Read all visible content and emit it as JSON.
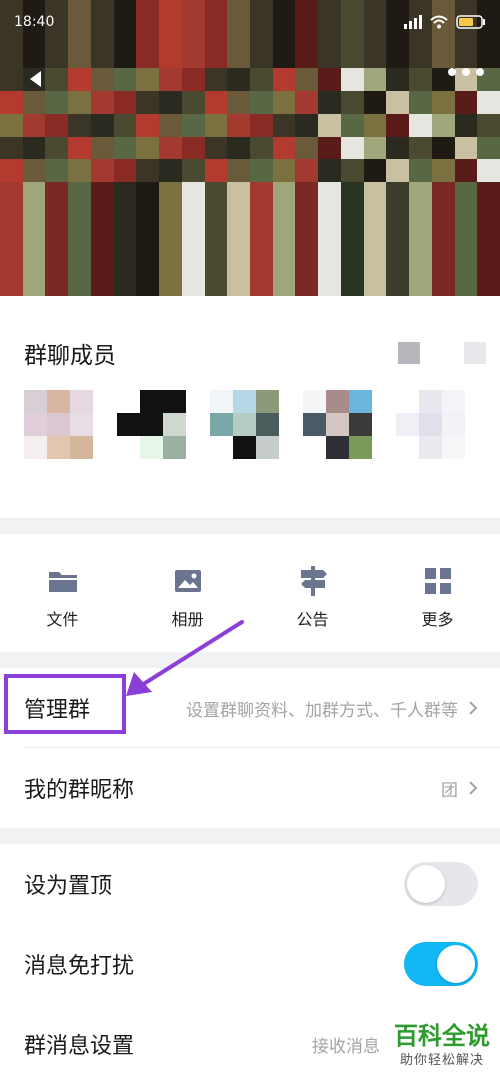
{
  "status_bar": {
    "time": "18:40"
  },
  "header": {
    "back_icon": "chevron-left-icon",
    "more_icon": "more-dots-icon",
    "cover_colors": [
      "#3b3528",
      "#6b5a3a",
      "#8a2a25",
      "#b33a2e",
      "#a33a30",
      "#4a4a30",
      "#7b7040",
      "#2b2a20",
      "#586844",
      "#9fa67a",
      "#c8c0a0",
      "#e6e6e0",
      "#201a14",
      "#5a1c18",
      "#7a2a24",
      "#3c3c2c",
      "#2a3424",
      "#a7b079",
      "#c6cf9a",
      "#dcdccc",
      "#16110c",
      "#4e3a2a"
    ]
  },
  "members": {
    "title": "群聊成员",
    "avatar_palettes": [
      [
        "#d8cfd6",
        "#d9b6a3",
        "#e6d8e2",
        "#e0cfda",
        "#dbc7d2",
        "#e7dde5",
        "#f4eeef",
        "#e2c6b0",
        "#d4b69b"
      ],
      [
        "#ffffff",
        "#111111",
        "#111111",
        "#111111",
        "#111111",
        "#cfd8cf",
        "#ffffff",
        "#e6f6e8",
        "#9bb0a0"
      ],
      [
        "#f0f6f8",
        "#b6d8e6",
        "#8c9a7a",
        "#7aa6a8",
        "#b4ccc2",
        "#4a5c5c",
        "#ffffff",
        "#111111",
        "#c6cbcb"
      ],
      [
        "#f3f5f7",
        "#a88c8c",
        "#6ab6dc",
        "#4a5a66",
        "#d4c6c0",
        "#3a3a3a",
        "#ffffff",
        "#2e2e36",
        "#7a9a5a"
      ],
      [
        "#ffffff",
        "#e8e8f0",
        "#f4f4f8",
        "#eef0f6",
        "#dfe0ea",
        "#f2f2f6",
        "#ffffff",
        "#e9e9ef",
        "#f6f6f8"
      ]
    ]
  },
  "actions": [
    {
      "label": "文件",
      "icon": "folder-icon",
      "name": "action-files"
    },
    {
      "label": "相册",
      "icon": "image-icon",
      "name": "action-album"
    },
    {
      "label": "公告",
      "icon": "signpost-icon",
      "name": "action-announcement"
    },
    {
      "label": "更多",
      "icon": "grid-icon",
      "name": "action-more"
    }
  ],
  "group_settings": {
    "manage": {
      "label": "管理群",
      "value": "设置群聊资料、加群方式、千人群等"
    },
    "nickname": {
      "label": "我的群昵称",
      "value": "团"
    }
  },
  "preferences": {
    "pin": {
      "label": "设为置顶",
      "enabled": false
    },
    "mute": {
      "label": "消息免打扰",
      "enabled": true
    },
    "message_settings": {
      "label": "群消息设置",
      "value": "接收消息"
    }
  },
  "watermark": {
    "main": "百科全说",
    "sub": "助你轻松解决"
  },
  "colors": {
    "accent": "#12b7f5",
    "highlight": "#8b3fd6",
    "brand_green": "#2d9b2d"
  }
}
